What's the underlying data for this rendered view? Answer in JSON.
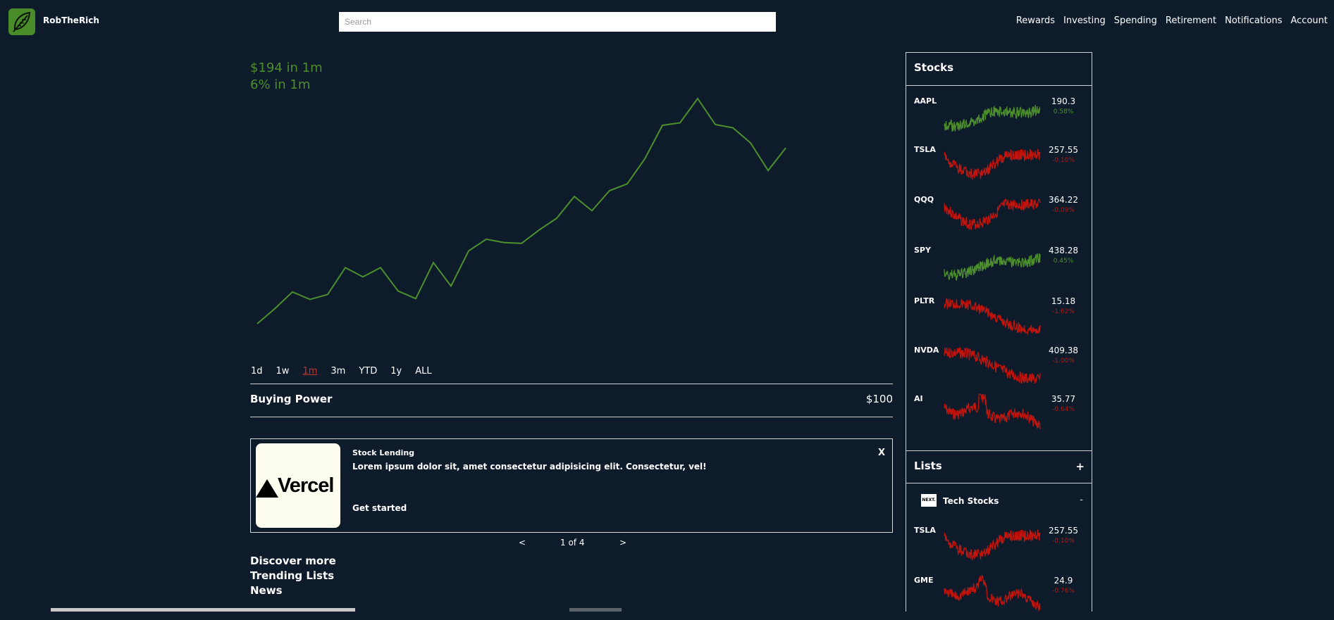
{
  "app": {
    "name": "RobTheRich",
    "logo_icon": "leaf-icon"
  },
  "search": {
    "placeholder": "Search"
  },
  "nav": {
    "items": [
      "Rewards",
      "Investing",
      "Spending",
      "Retirement",
      "Notifications",
      "Account"
    ]
  },
  "portfolio": {
    "gain_amount": "$194 in 1m",
    "gain_percent": "6% in 1m",
    "line_color": "#4d8f2d",
    "chart_data": {
      "type": "line",
      "values": [
        352,
        370,
        390,
        381,
        387,
        419,
        408,
        419,
        391,
        382,
        425,
        397,
        439,
        453,
        449,
        448,
        464,
        478,
        504,
        487,
        511,
        519,
        549,
        589,
        592,
        621,
        590,
        586,
        568,
        535,
        562
      ]
    }
  },
  "ranges": {
    "options": [
      "1d",
      "1w",
      "1m",
      "3m",
      "YTD",
      "1y",
      "ALL"
    ],
    "selected": "1m"
  },
  "buying_power": {
    "label": "Buying Power",
    "value": "$100"
  },
  "promo": {
    "logo_text": "Vercel",
    "title": "Stock Lending",
    "body": "Lorem ipsum dolor sit, amet consectetur adipisicing elit. Consectetur, vel!",
    "cta": "Get started",
    "close": "X"
  },
  "pager": {
    "prev": "<",
    "label": "1 of 4",
    "next": ">"
  },
  "links": [
    "Discover more",
    "Trending Lists",
    "News"
  ],
  "stocks": {
    "title": "Stocks",
    "items": [
      {
        "symbol": "AAPL",
        "price": "190.3",
        "change": "0.58%",
        "direction": "up"
      },
      {
        "symbol": "TSLA",
        "price": "257.55",
        "change": "-0.10%",
        "direction": "down"
      },
      {
        "symbol": "QQQ",
        "price": "364.22",
        "change": "-0.09%",
        "direction": "down"
      },
      {
        "symbol": "SPY",
        "price": "438.28",
        "change": "0.45%",
        "direction": "up"
      },
      {
        "symbol": "PLTR",
        "price": "15.18",
        "change": "-1.62%",
        "direction": "down"
      },
      {
        "symbol": "NVDA",
        "price": "409.38",
        "change": "-1.00%",
        "direction": "down"
      },
      {
        "symbol": "AI",
        "price": "35.77",
        "change": "-0.64%",
        "direction": "down"
      }
    ]
  },
  "lists": {
    "title": "Lists",
    "add": "+",
    "groups": [
      {
        "icon_text": "NEXT.",
        "name": "Tech Stocks",
        "collapse": "-",
        "items": [
          {
            "symbol": "TSLA",
            "price": "257.55",
            "change": "-0.10%",
            "direction": "down"
          },
          {
            "symbol": "GME",
            "price": "24.9",
            "change": "-0.76%",
            "direction": "down"
          }
        ]
      }
    ]
  },
  "colors": {
    "up": "#4d8f2d",
    "down": "#c0140c",
    "background": "#0d1b2a"
  }
}
